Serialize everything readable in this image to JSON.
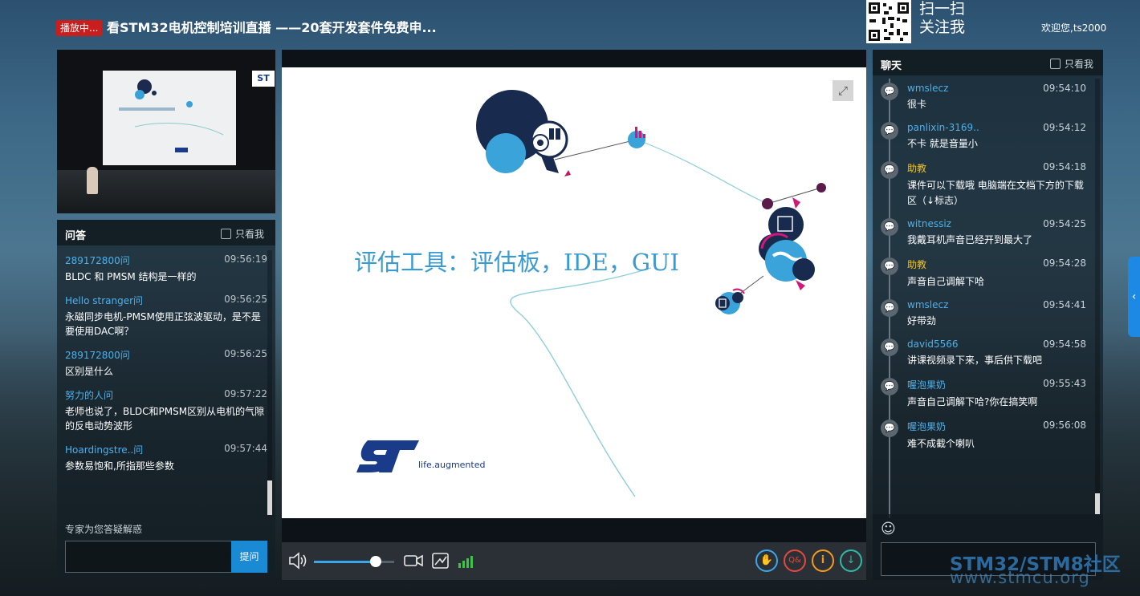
{
  "header": {
    "live_badge": "播放中...",
    "title": "看STM32电机控制培训直播 ——20套开发套件免费申...",
    "qr_line1": "扫一扫",
    "qr_line2": "关注我",
    "welcome": "欢迎您,ts2000"
  },
  "qa": {
    "title": "问答",
    "only_me": "只看我",
    "items": [
      {
        "user": "289172800问",
        "time": "09:56:19",
        "text": "BLDC 和 PMSM 结构是一样的"
      },
      {
        "user": "Hello stranger问",
        "time": "09:56:25",
        "text": "永磁同步电机-PMSM使用正弦波驱动，是不是要使用DAC啊？"
      },
      {
        "user": "289172800问",
        "time": "09:56:25",
        "text": "区别是什么"
      },
      {
        "user": "努力的人问",
        "time": "09:57:22",
        "text": "老师也说了，BLDC和PMSM区别从电机的气隙的反电动势波形"
      },
      {
        "user": "Hoardingstre..问",
        "time": "09:57:44",
        "text": "参数易饱和,所指那些参数"
      }
    ],
    "footer_label": "专家为您答疑解惑",
    "ask_button": "提问"
  },
  "slide": {
    "text": "评估工具：评估板，IDE，GUI",
    "tagline": "life.augmented"
  },
  "player": {
    "volume": 0.77,
    "colors": {
      "volume": "#3ba7e8",
      "signal": "#3ec24a",
      "hand": "#3ba7e8",
      "qa": "#e5483e",
      "info": "#f39a1e",
      "download": "#2dbba6"
    }
  },
  "chat": {
    "title": "聊天",
    "only_me": "只看我",
    "items": [
      {
        "user": "wmslecz",
        "time": "09:54:10",
        "text": "很卡",
        "color": "#4fb0ea"
      },
      {
        "user": "panlixin-3169..",
        "time": "09:54:12",
        "text": "不卡 就是音量小",
        "color": "#4fb0ea"
      },
      {
        "user": "助教",
        "time": "09:54:18",
        "text": "课件可以下载哦 电脑端在文档下方的下载区（↓标志）",
        "color": "#f3c21e"
      },
      {
        "user": "witnessiz",
        "time": "09:54:25",
        "text": "我戴耳机声音已经开到最大了",
        "color": "#4fb0ea"
      },
      {
        "user": "助教",
        "time": "09:54:28",
        "text": "声音自己调解下哈",
        "color": "#f3c21e"
      },
      {
        "user": "wmslecz",
        "time": "09:54:41",
        "text": "好带劲",
        "color": "#4fb0ea"
      },
      {
        "user": "david5566",
        "time": "09:54:58",
        "text": "讲课视频录下来，事后供下载吧",
        "color": "#4fb0ea"
      },
      {
        "user": "喔泡果奶",
        "time": "09:55:43",
        "text": "声音自己调解下哈?你在搞笑啊",
        "color": "#4fb0ea"
      },
      {
        "user": "喔泡果奶",
        "time": "09:56:08",
        "text": "难不成截个喇叭",
        "color": "#4fb0ea"
      }
    ]
  },
  "watermark": {
    "line1": "STM32/STM8社区",
    "line2": "www.stmcu.org"
  }
}
